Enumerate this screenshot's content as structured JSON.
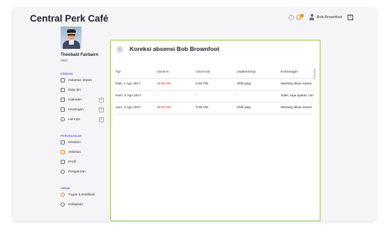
{
  "app": {
    "title": "Central Perk Café"
  },
  "topbar": {
    "help_icon": "?",
    "user_name": "Bob Brownfoot",
    "help_box": "?"
  },
  "profile": {
    "name": "Theobald Fairbairn",
    "role": "CEO"
  },
  "sidebar": {
    "sections": [
      {
        "label": "PRIBADI"
      },
      {
        "label": "PERUSAHAAN"
      },
      {
        "label": "UMUM"
      }
    ],
    "pribadi": [
      {
        "label": "Halaman depan",
        "icon": "home-icon"
      },
      {
        "label": "Data diri",
        "icon": "id-card-icon"
      },
      {
        "label": "Kalender",
        "icon": "calendar-icon",
        "plus": "+"
      },
      {
        "label": "Keuangan",
        "icon": "money-icon",
        "plus": "+"
      },
      {
        "label": "Lainnya",
        "icon": "more-icon",
        "plus": "+"
      }
    ],
    "perusahaan": [
      {
        "label": "Direktori",
        "icon": "directory-icon"
      },
      {
        "label": "Aktivitas",
        "icon": "activity-icon"
      },
      {
        "label": "Profil",
        "icon": "building-icon"
      },
      {
        "label": "Pengaturan",
        "icon": "settings-icon"
      }
    ],
    "umum": [
      {
        "label": "Tugas & Notifikasi",
        "icon": "task-bell-icon"
      },
      {
        "label": "Kebijakan",
        "icon": "policy-icon"
      }
    ]
  },
  "panel": {
    "back_icon": "‹",
    "title": "Koreksi absensi Bob Brownfoot",
    "columns": [
      "Tgl",
      "Clock-in",
      "Clock-out",
      "Jadwal kerja",
      "Keterangan"
    ],
    "rows": [
      {
        "date": "Rab, 1 Agu 2017",
        "clock_in": "10:00 AM",
        "clock_out": "5:40 PM",
        "schedule": "Shift pagi",
        "note": "Meeting diluar kantor"
      },
      {
        "date": "Kam, 2 Agu 2017",
        "clock_in": "-",
        "clock_out": "-",
        "schedule": "-",
        "note": "Sakit, lupa ajukan cuti"
      },
      {
        "date": "Jum, 3 Agu 2017",
        "clock_in": "10:00 AM",
        "clock_out": "6:00 PM",
        "schedule": "Shift pagi",
        "note": "Meeting diluar kantor"
      }
    ]
  },
  "colors": {
    "accent": "#5b4de0",
    "panel_border": "#8cc54b",
    "late": "#d81b1b",
    "notification": "#ee8a1b"
  }
}
